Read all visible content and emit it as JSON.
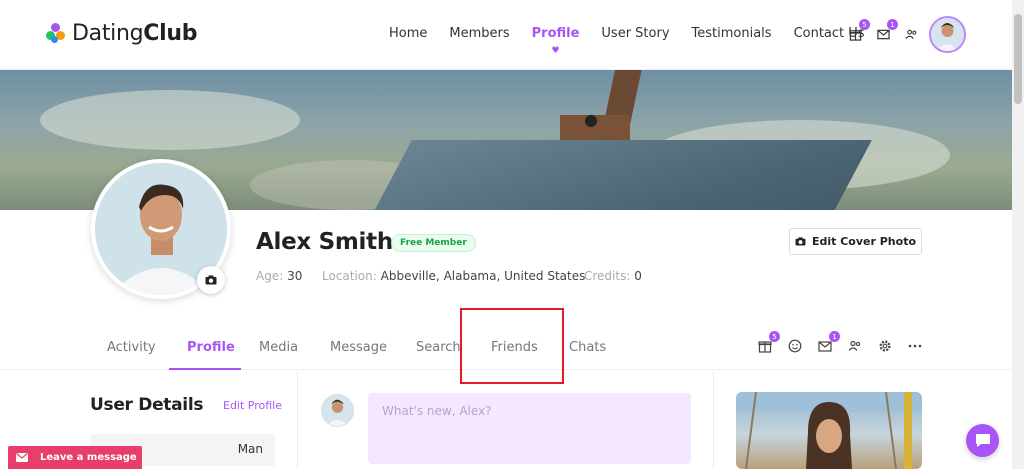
{
  "brand": {
    "name_light": "Dating",
    "name_bold": "Club"
  },
  "nav": {
    "items": [
      {
        "label": "Home",
        "active": false
      },
      {
        "label": "Members",
        "active": false
      },
      {
        "label": "Profile",
        "active": true
      },
      {
        "label": "User Story",
        "active": false
      },
      {
        "label": "Testimonials",
        "active": false
      },
      {
        "label": "Contact Us",
        "active": false
      }
    ]
  },
  "header_badges": {
    "gifts": "5",
    "messages": "1"
  },
  "profile": {
    "name": "Alex Smith",
    "membership": "Free Member",
    "age_label": "Age:",
    "age_value": "30",
    "location_label": "Location:",
    "location_value": "Abbeville, Alabama, United States",
    "credits_label": "Credits:",
    "credits_value": "0",
    "edit_cover_label": "Edit Cover Photo"
  },
  "tabs": [
    {
      "label": "Activity",
      "active": false
    },
    {
      "label": "Profile",
      "active": true
    },
    {
      "label": "Media",
      "active": false
    },
    {
      "label": "Message",
      "active": false
    },
    {
      "label": "Search",
      "active": false
    },
    {
      "label": "Friends",
      "active": false
    },
    {
      "label": "Chats",
      "active": false
    }
  ],
  "tab_badges": {
    "gifts": "5",
    "messages": "1"
  },
  "user_details": {
    "title": "User Details",
    "edit_label": "Edit Profile",
    "gender_value": "Man"
  },
  "post": {
    "placeholder": "What's new, Alex?"
  },
  "widgets": {
    "leave_message": "Leave a message"
  },
  "colors": {
    "accent": "#a855f7",
    "highlight": "#e11d2a",
    "leave_message_bg": "#e53f6a"
  },
  "icons": [
    "gift-icon",
    "mail-icon",
    "users-icon",
    "camera-icon",
    "smiley-icon",
    "gear-icon",
    "more-icon",
    "chat-icon",
    "heart-icon"
  ]
}
